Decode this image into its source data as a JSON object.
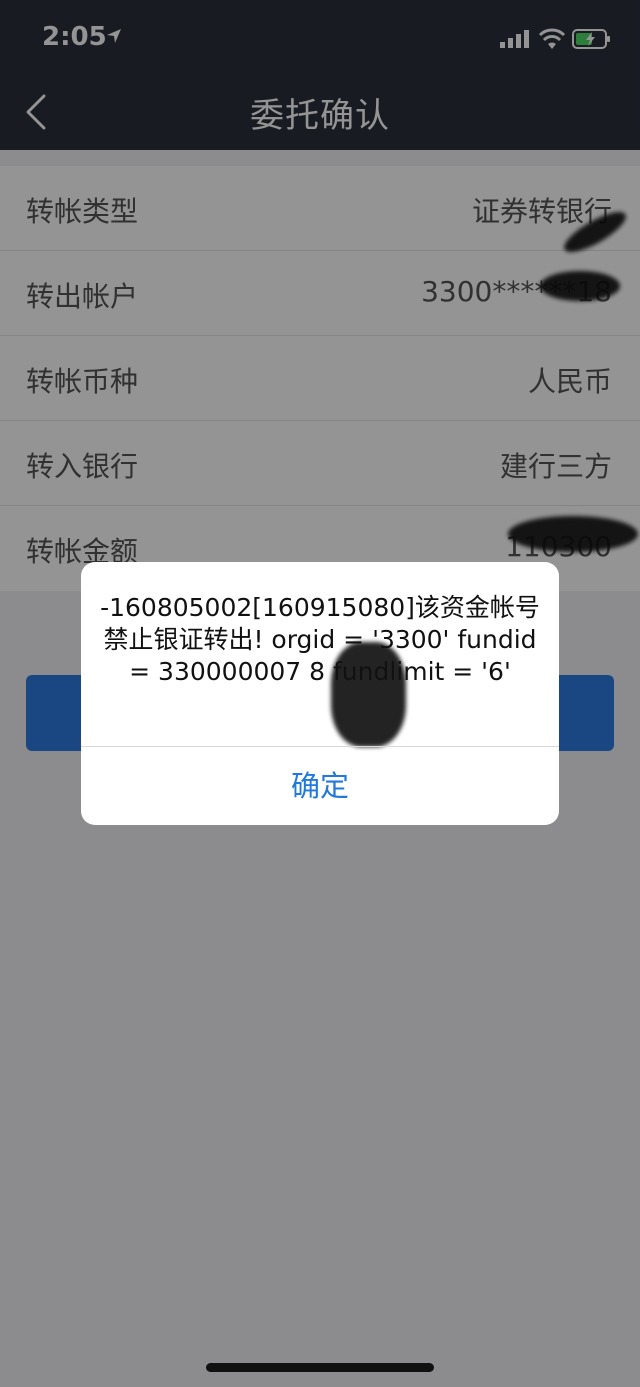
{
  "status_bar": {
    "time": "2:05"
  },
  "nav": {
    "title": "委托确认"
  },
  "form": {
    "rows": [
      {
        "label": "转帐类型",
        "value": "证券转银行"
      },
      {
        "label": "转出帐户",
        "value": "3300******18"
      },
      {
        "label": "转帐币种",
        "value": "人民币"
      },
      {
        "label": "转入银行",
        "value": "建行三方"
      },
      {
        "label": "转帐金额",
        "value": "110300"
      }
    ]
  },
  "alert": {
    "message": "-160805002[160915080]该资金帐号禁止银证转出! orgid = '3300' fundid = 330000007 8 fundlimit = '6'",
    "ok_label": "确定"
  },
  "colors": {
    "nav_bg": "#2a2f3c",
    "accent": "#2e7be0",
    "alert_button": "#1f7adb",
    "battery": "#4cd964"
  }
}
